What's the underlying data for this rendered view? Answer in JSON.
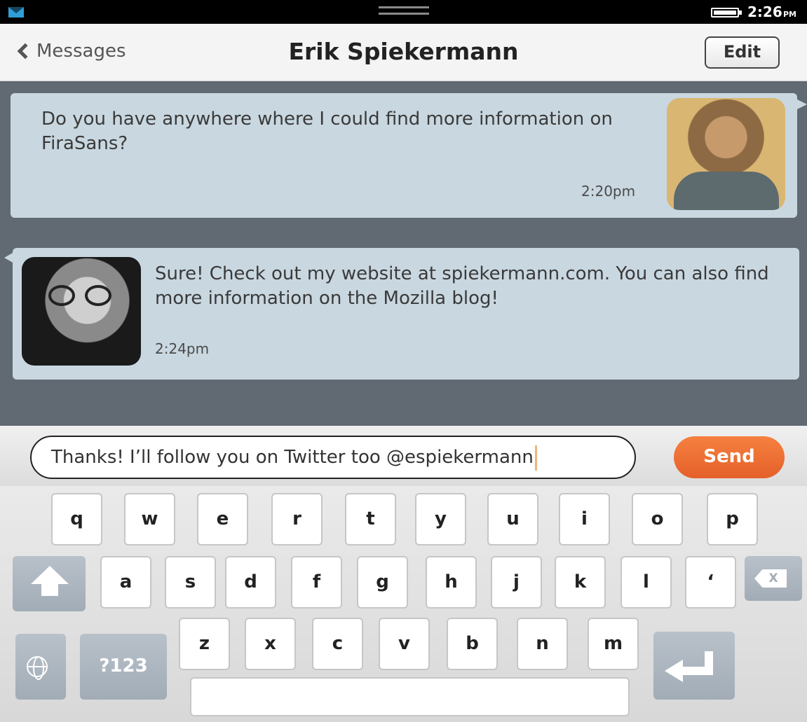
{
  "status_bar": {
    "time": "2:26",
    "ampm": "PM",
    "icons": [
      "mail-icon",
      "battery-icon"
    ]
  },
  "header": {
    "back_label": "Messages",
    "title": "Erik Spiekermann",
    "edit_label": "Edit"
  },
  "messages": [
    {
      "direction": "outgoing",
      "text": "Do you have anywhere where I could find more information on FiraSans?",
      "time": "2:20pm"
    },
    {
      "direction": "incoming",
      "text": "Sure! Check out my website at spiekermann.com. You can also find more information on the Mozilla blog!",
      "time": "2:24pm"
    }
  ],
  "compose": {
    "value": "Thanks! I’ll follow you on Twitter too @espiekermann",
    "send_label": "Send"
  },
  "keyboard": {
    "row1": [
      "q",
      "w",
      "e",
      "r",
      "t",
      "y",
      "u",
      "i",
      "o",
      "p"
    ],
    "row2": [
      "a",
      "s",
      "d",
      "f",
      "g",
      "h",
      "j",
      "k",
      "l",
      "‘"
    ],
    "row3": [
      "z",
      "x",
      "c",
      "v",
      "b",
      "n",
      "m"
    ],
    "backspace_label": "X",
    "symbols_label": "?123",
    "colors": {
      "send": "#e5602a",
      "thread_bg": "#616973",
      "bubble": "#c9d7e0"
    }
  }
}
